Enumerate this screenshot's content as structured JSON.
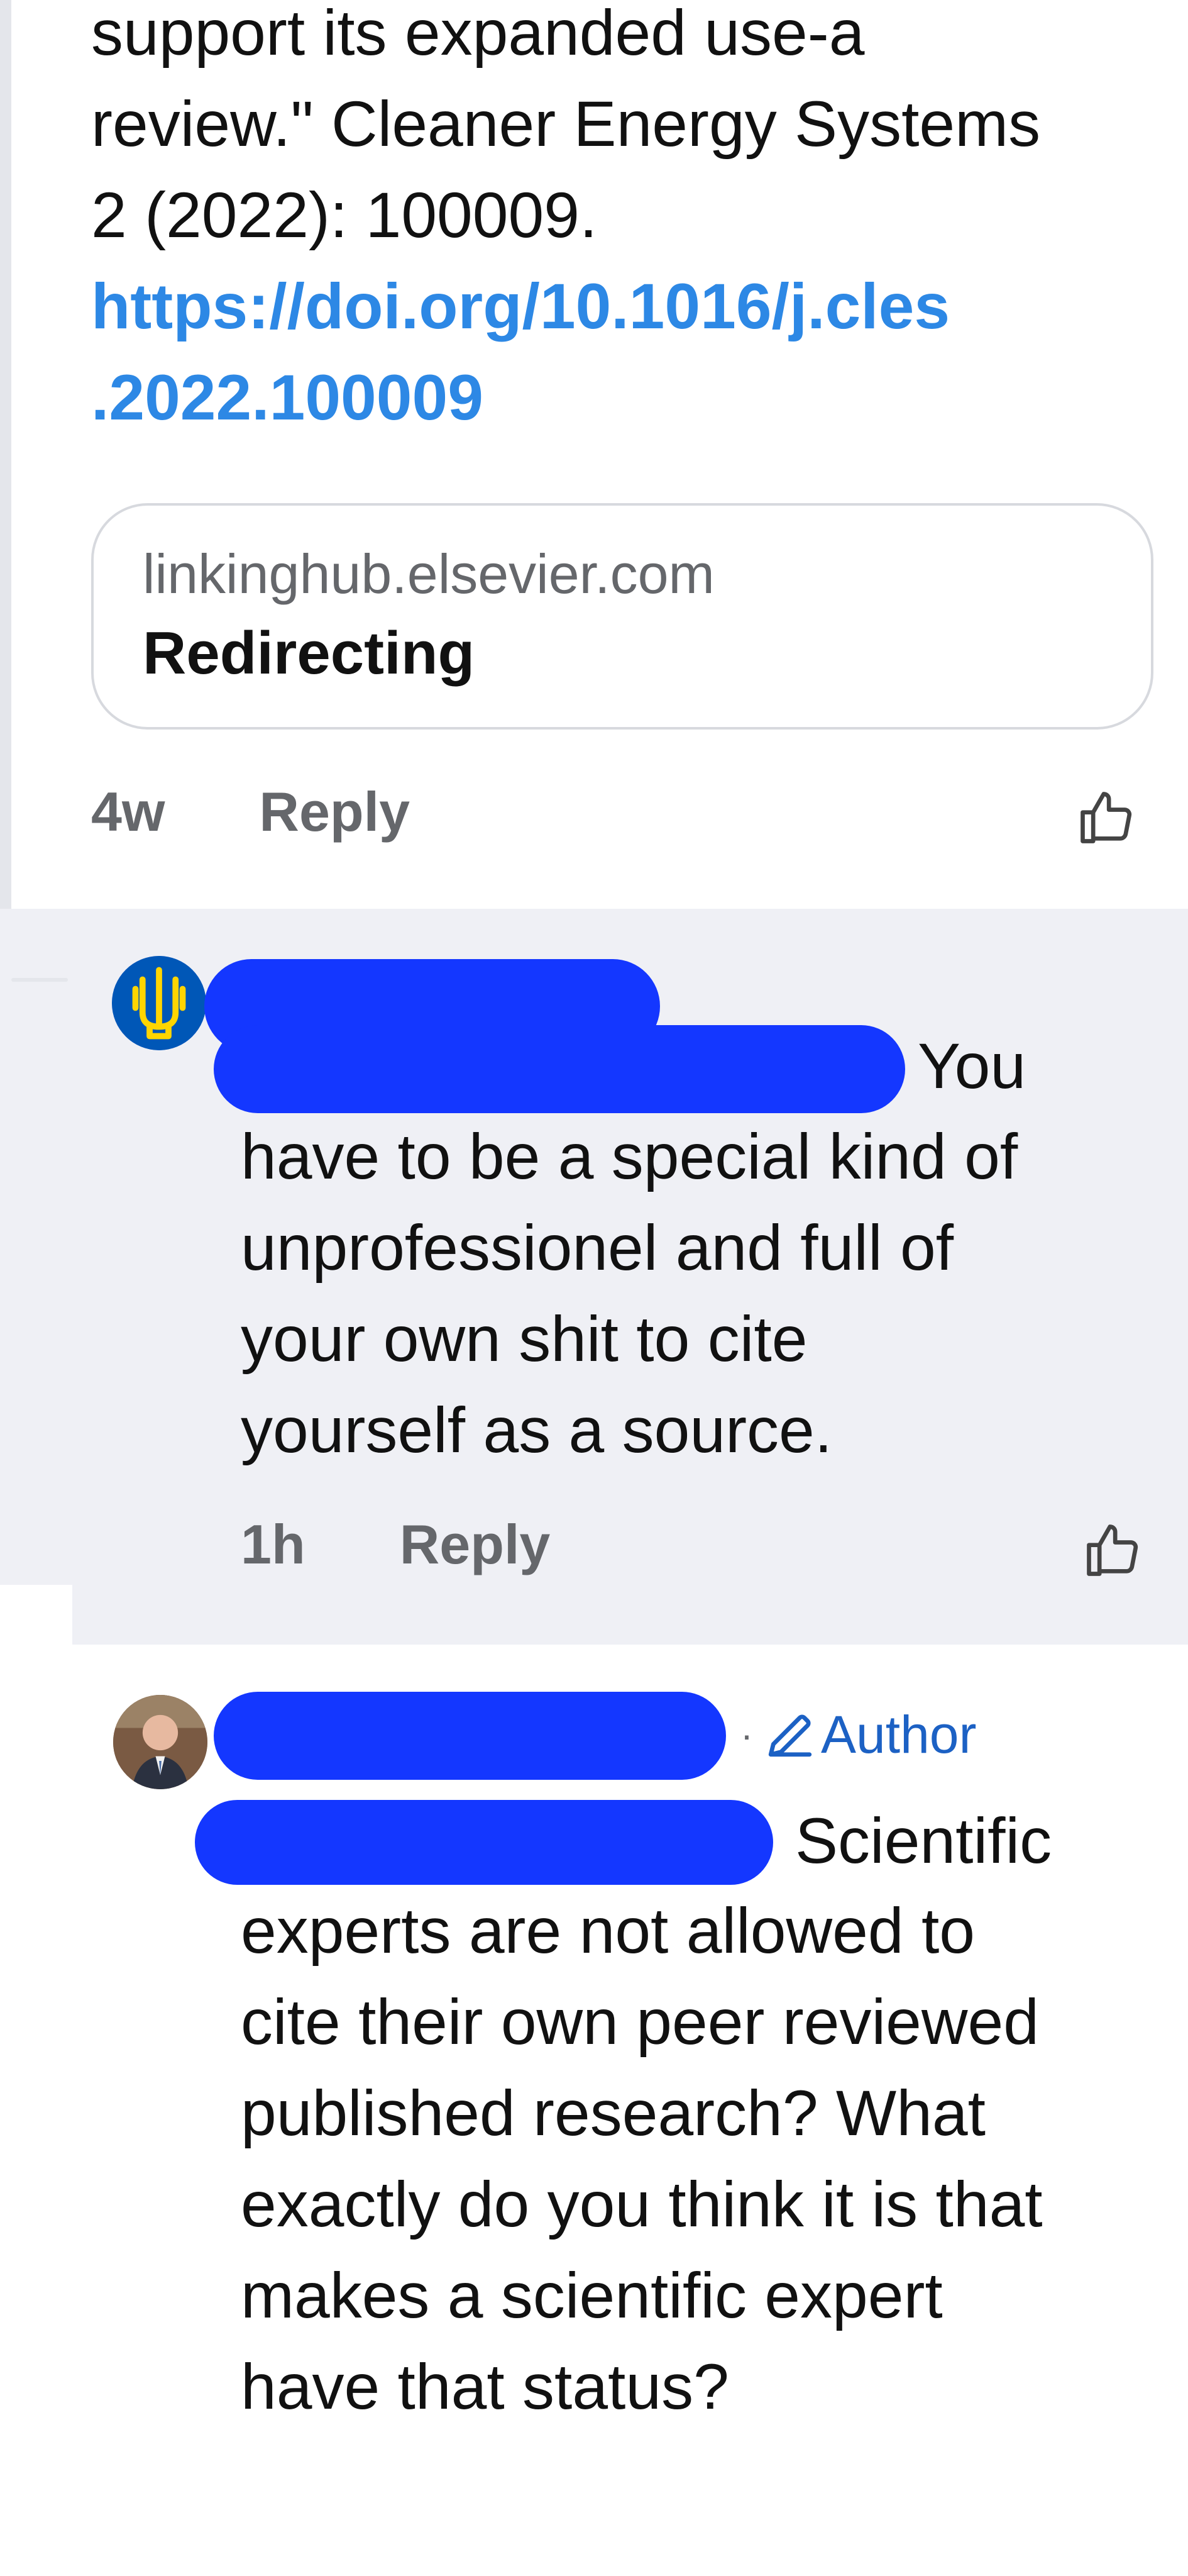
{
  "first_comment": {
    "text_lines": [
      "support its expanded use-a",
      "review.\" Cleaner Energy Systems",
      "2 (2022): 100009."
    ],
    "link_lines": [
      "https://doi.org/10.1016/j.cles",
      ".2022.100009"
    ],
    "link_preview": {
      "domain": "linkinghub.elsevier.com",
      "title": "Redirecting"
    },
    "timestamp": "4w",
    "reply_label": "Reply",
    "like_icon": "thumbs-up-icon"
  },
  "second_comment": {
    "avatar_icon": "ukraine-trident-icon",
    "inline_start": "You",
    "text_lines": [
      "have to be a special kind of",
      "unprofessionel and full of",
      "your own shit to cite",
      "yourself as a source."
    ],
    "timestamp": "1h",
    "reply_label": "Reply",
    "like_icon": "thumbs-up-icon",
    "background": "#eff0f5"
  },
  "third_comment": {
    "avatar_icon": "person-avatar",
    "author_badge": "Author",
    "badge_icon": "pencil-icon",
    "inline_start": "Scientific",
    "text_lines": [
      "experts are not allowed to",
      "cite their own peer reviewed",
      "published research? What",
      "exactly do you think it is that",
      "makes a scientific expert",
      "have that status?"
    ]
  },
  "colors": {
    "link": "#2d88e5",
    "redaction": "#1437ff",
    "author_badge": "#1c61c4",
    "muted_text": "#65676b"
  }
}
